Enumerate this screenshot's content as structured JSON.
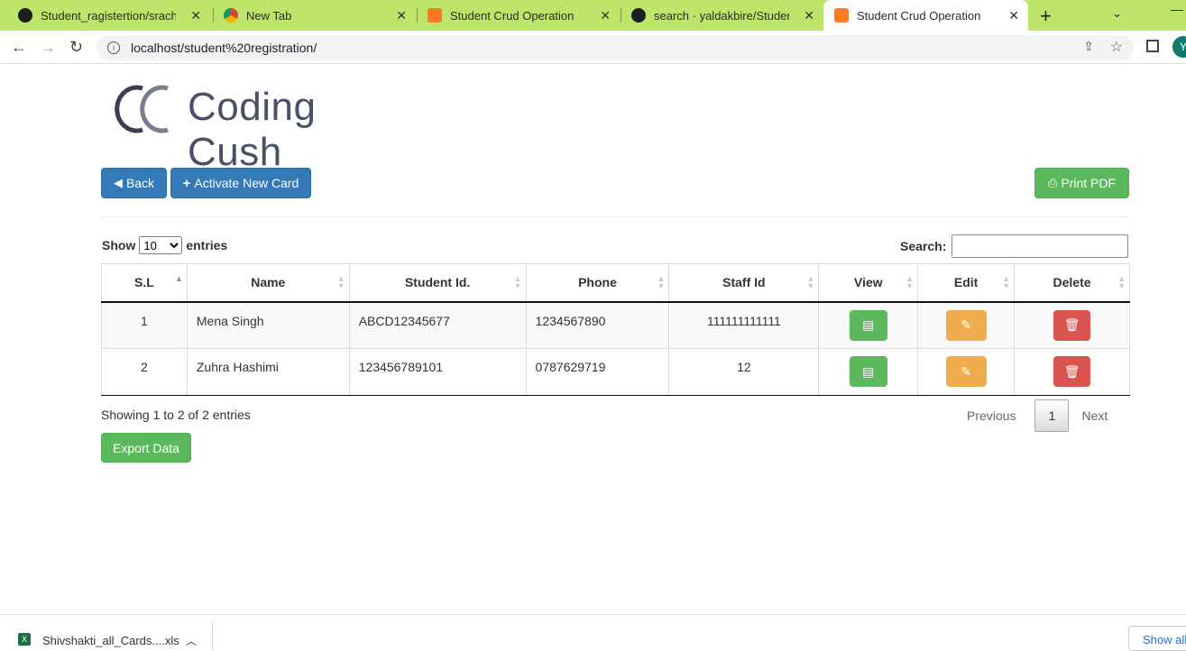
{
  "browser": {
    "tabs": [
      {
        "title": "Student_ragistertion/srach.PNG",
        "favicon": "github-icon",
        "active": false
      },
      {
        "title": "New Tab",
        "favicon": "chrome-icon",
        "active": false
      },
      {
        "title": "Student Crud Operation",
        "favicon": "xampp-icon",
        "active": false
      },
      {
        "title": "search · yaldakbire/Student_ra...",
        "favicon": "github-icon",
        "active": false
      },
      {
        "title": "Student Crud Operation",
        "favicon": "xampp-icon",
        "active": true
      }
    ],
    "url": "localhost/student%20registration/",
    "profile_initial": "Y"
  },
  "page": {
    "logo_text": "Coding Cush",
    "back_label": "Back",
    "activate_label": "Activate New Card",
    "print_label": "Print PDF",
    "show_label": "Show",
    "entries_label": "entries",
    "page_length": "10",
    "search_label": "Search:",
    "search_value": "",
    "info_text": "Showing 1 to 2 of 2 entries",
    "previous_label": "Previous",
    "current_page": "1",
    "next_label": "Next",
    "export_label": "Export Data"
  },
  "table": {
    "columns": [
      "S.L",
      "Name",
      "Student Id.",
      "Phone",
      "Staff Id",
      "View",
      "Edit",
      "Delete"
    ],
    "rows": [
      {
        "sl": "1",
        "name": "Mena Singh",
        "student_id": "ABCD12345677",
        "phone": "1234567890",
        "staff_id": "111111111111"
      },
      {
        "sl": "2",
        "name": "Zuhra Hashimi",
        "student_id": "123456789101",
        "phone": "0787629719",
        "staff_id": "12"
      }
    ]
  },
  "downloads": {
    "file_name": "Shivshakti_all_Cards....xls",
    "show_all_label": "Show all"
  },
  "colors": {
    "tabbar": "#bde56a",
    "primary": "#337ab7",
    "success": "#5cb85c",
    "warning": "#f0ad4e",
    "danger": "#d9534f"
  }
}
